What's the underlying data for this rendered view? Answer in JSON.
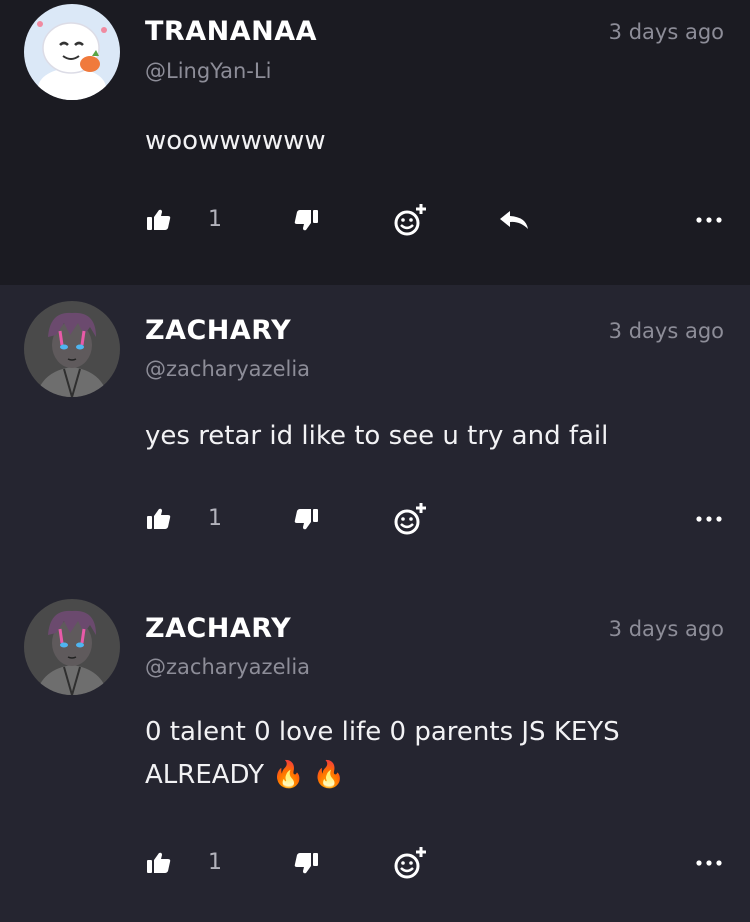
{
  "comments": [
    {
      "username": "TRANANAA",
      "handle": "@LingYan-Li",
      "time": "3 days ago",
      "text": "woowwwwww",
      "likes": "1",
      "avatar_icon": "cartoon-character-avatar",
      "has_reply": true
    },
    {
      "username": "ZACHARY",
      "handle": "@zacharyazelia",
      "time": "3 days ago",
      "text": "yes retar id like to see u try and fail",
      "likes": "1",
      "avatar_icon": "anime-character-avatar",
      "has_reply": false
    },
    {
      "username": "ZACHARY",
      "handle": "@zacharyazelia",
      "time": "3 days ago",
      "text": "0 talent 0 love life 0 parents JS KEYS ALREADY 🔥 🔥",
      "likes": "1",
      "avatar_icon": "anime-character-avatar",
      "has_reply": false
    }
  ],
  "icons": {
    "like": "thumbs-up-icon",
    "dislike": "thumbs-down-icon",
    "react": "add-emoji-icon",
    "reply": "reply-arrow-icon",
    "more": "more-dots-icon"
  },
  "colors": {
    "background": "#252530",
    "first_comment_background": "#1b1b22",
    "muted_text": "#8d8d98",
    "text": "#ffffff"
  }
}
